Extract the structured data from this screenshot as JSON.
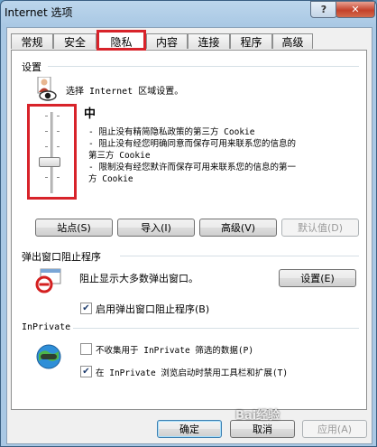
{
  "window": {
    "title": "Internet 选项",
    "help_glyph": "?",
    "close_glyph": "✕"
  },
  "tabs": [
    {
      "label": "常规",
      "active": false
    },
    {
      "label": "安全",
      "active": false
    },
    {
      "label": "隐私",
      "active": true
    },
    {
      "label": "内容",
      "active": false
    },
    {
      "label": "连接",
      "active": false
    },
    {
      "label": "程序",
      "active": false
    },
    {
      "label": "高级",
      "active": false
    }
  ],
  "settings": {
    "group_label": "设置",
    "description": "选择 Internet 区域设置。",
    "level_name": "中",
    "level_lines": [
      "- 阻止没有精简隐私政策的第三方 Cookie",
      "- 阻止没有经您明确同意而保存可用来联系您的信息的第三方 Cookie",
      "- 限制没有经您默许而保存可用来联系您的信息的第一方 Cookie"
    ],
    "slider_level": 0.62,
    "buttons": {
      "sites": "站点(S)",
      "import": "导入(I)",
      "advanced": "高级(V)",
      "default": "默认值(D)"
    }
  },
  "popup": {
    "group_label": "弹出窗口阻止程序",
    "description": "阻止显示大多数弹出窗口。",
    "settings_button": "设置(E)",
    "enable_label": "启用弹出窗口阻止程序(B)",
    "enable_checked": true
  },
  "inprivate": {
    "group_label": "InPrivate",
    "no_collect_label": "不收集用于 InPrivate 筛选的数据(P)",
    "no_collect_checked": false,
    "disable_toolbars_label": "在 InPrivate 浏览启动时禁用工具栏和扩展(T)",
    "disable_toolbars_checked": true
  },
  "footer": {
    "ok": "确定",
    "cancel": "取消",
    "apply": "应用(A)"
  },
  "watermark": "Bai经验"
}
